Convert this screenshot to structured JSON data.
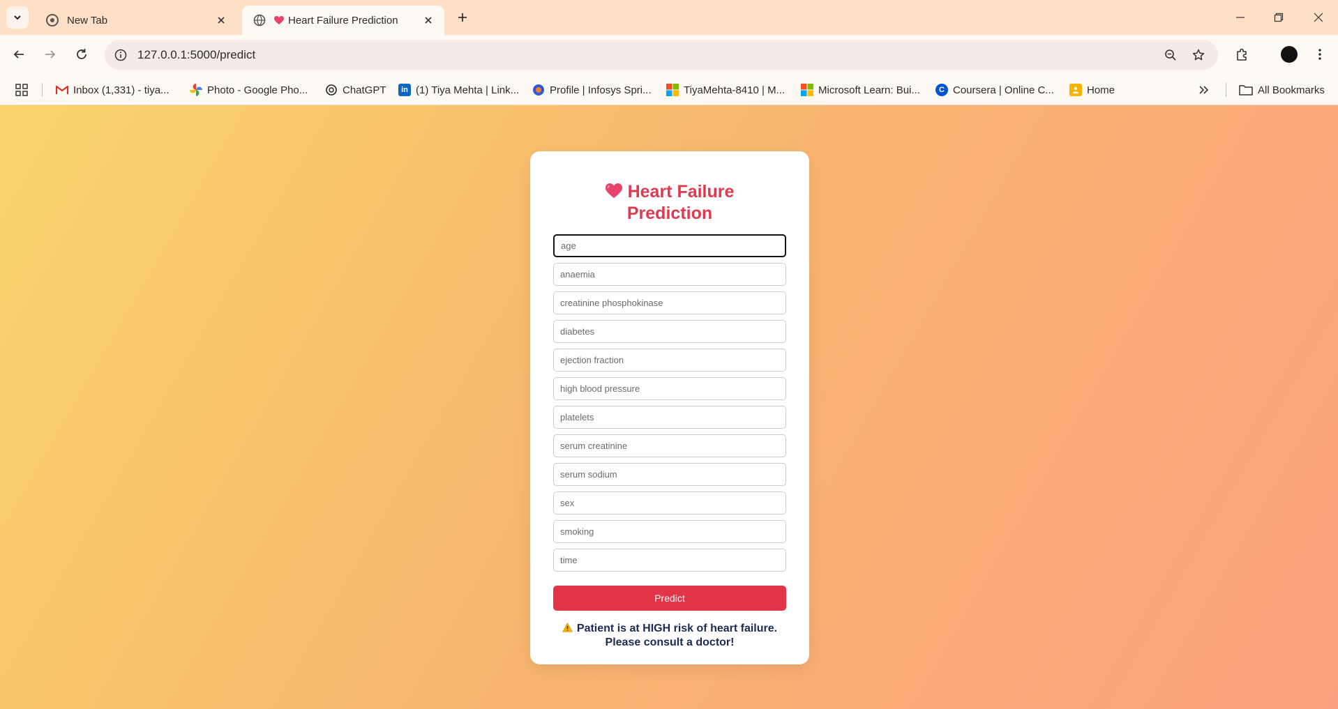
{
  "browser": {
    "tabs": [
      {
        "title": "New Tab",
        "favicon": "chrome-icon"
      },
      {
        "title": "Heart Failure Prediction",
        "favicon": "heart-icon"
      }
    ],
    "url": "127.0.0.1:5000/predict",
    "bookmarks": [
      {
        "label": "Inbox (1,331) - tiya...",
        "icon": "gmail-icon"
      },
      {
        "label": "Photo - Google Pho...",
        "icon": "google-photos-icon"
      },
      {
        "label": "ChatGPT",
        "icon": "chatgpt-icon"
      },
      {
        "label": "(1) Tiya Mehta | Link...",
        "icon": "linkedin-icon"
      },
      {
        "label": "Profile | Infosys Spri...",
        "icon": "infosys-icon"
      },
      {
        "label": "TiyaMehta-8410 | M...",
        "icon": "microsoft-icon"
      },
      {
        "label": "Microsoft Learn: Bui...",
        "icon": "microsoft-icon"
      },
      {
        "label": "Coursera | Online C...",
        "icon": "coursera-icon"
      },
      {
        "label": "Home",
        "icon": "classroom-icon"
      }
    ],
    "all_bookmarks_label": "All Bookmarks"
  },
  "form": {
    "title_line1": "Heart Failure",
    "title_line2": "Prediction",
    "fields": [
      {
        "placeholder": "age",
        "value": ""
      },
      {
        "placeholder": "anaemia",
        "value": ""
      },
      {
        "placeholder": "creatinine phosphokinase",
        "value": ""
      },
      {
        "placeholder": "diabetes",
        "value": ""
      },
      {
        "placeholder": "ejection fraction",
        "value": ""
      },
      {
        "placeholder": "high blood pressure",
        "value": ""
      },
      {
        "placeholder": "platelets",
        "value": ""
      },
      {
        "placeholder": "serum creatinine",
        "value": ""
      },
      {
        "placeholder": "serum sodium",
        "value": ""
      },
      {
        "placeholder": "sex",
        "value": ""
      },
      {
        "placeholder": "smoking",
        "value": ""
      },
      {
        "placeholder": "time",
        "value": ""
      }
    ],
    "submit_label": "Predict",
    "result_line1": "Patient is at HIGH risk of heart failure.",
    "result_line2": "Please consult a doctor!"
  },
  "colors": {
    "accent": "#e33548",
    "title": "#e0394f",
    "result_text": "#1b2a55"
  }
}
